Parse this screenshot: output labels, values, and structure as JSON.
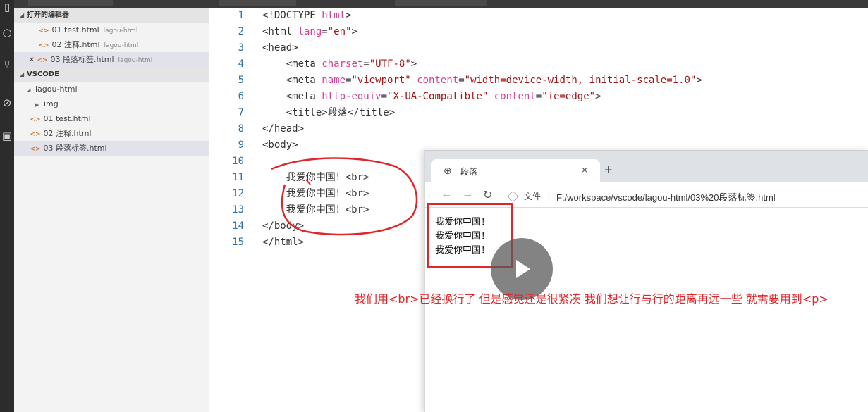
{
  "activity_icons": [
    "files-icon",
    "search-icon",
    "source-control-icon",
    "debug-icon",
    "extensions-icon"
  ],
  "sidebar": {
    "open_editors": {
      "label": "打开的编辑器",
      "items": [
        {
          "name": "01 test.html",
          "project": "lagou-html",
          "active": false
        },
        {
          "name": "02 注释.html",
          "project": "lagou-html",
          "active": false
        },
        {
          "name": "03 段落标签.html",
          "project": "lagou-html",
          "active": true
        }
      ]
    },
    "workspace": {
      "label": "VSCODE",
      "folder": "lagou-html",
      "subfolder": "img",
      "files": [
        "01 test.html",
        "02 注释.html",
        "03 段落标签.html"
      ]
    }
  },
  "editor": {
    "lines": [
      {
        "n": "1",
        "t": [
          [
            "tag",
            "<!DOCTYPE "
          ],
          [
            "doc",
            "html"
          ],
          [
            "tag",
            ">"
          ]
        ]
      },
      {
        "n": "2",
        "t": [
          [
            "tag",
            "<html "
          ],
          [
            "attr",
            "lang"
          ],
          [
            "tag",
            "="
          ],
          [
            "str",
            "\"en\""
          ],
          [
            "tag",
            ">"
          ]
        ]
      },
      {
        "n": "3",
        "t": [
          [
            "tag",
            "<head>"
          ]
        ]
      },
      {
        "n": "4",
        "t": [
          [
            "tag",
            "    <meta "
          ],
          [
            "attr",
            "charset"
          ],
          [
            "tag",
            "="
          ],
          [
            "str",
            "\"UTF-8\""
          ],
          [
            "tag",
            ">"
          ]
        ]
      },
      {
        "n": "5",
        "t": [
          [
            "tag",
            "    <meta "
          ],
          [
            "attr",
            "name"
          ],
          [
            "tag",
            "="
          ],
          [
            "str",
            "\"viewport\""
          ],
          [
            "tag",
            " "
          ],
          [
            "attr",
            "content"
          ],
          [
            "tag",
            "="
          ],
          [
            "str",
            "\"width=device-width, initial-scale=1.0\""
          ],
          [
            "tag",
            ">"
          ]
        ]
      },
      {
        "n": "6",
        "t": [
          [
            "tag",
            "    <meta "
          ],
          [
            "attr",
            "http-equiv"
          ],
          [
            "tag",
            "="
          ],
          [
            "str",
            "\"X-UA-Compatible\""
          ],
          [
            "tag",
            " "
          ],
          [
            "attr",
            "content"
          ],
          [
            "tag",
            "="
          ],
          [
            "str",
            "\"ie=edge\""
          ],
          [
            "tag",
            ">"
          ]
        ]
      },
      {
        "n": "7",
        "t": [
          [
            "tag",
            "    <title>段落</title>"
          ]
        ]
      },
      {
        "n": "8",
        "t": [
          [
            "tag",
            "</head>"
          ]
        ]
      },
      {
        "n": "9",
        "t": [
          [
            "tag",
            "<body>"
          ]
        ]
      },
      {
        "n": "10",
        "t": [
          [
            "tag",
            ""
          ]
        ]
      },
      {
        "n": "11",
        "t": [
          [
            "tag",
            "    我爱你中国！<br>"
          ]
        ]
      },
      {
        "n": "12",
        "t": [
          [
            "tag",
            "    我爱你中国！<br>"
          ]
        ]
      },
      {
        "n": "13",
        "t": [
          [
            "tag",
            "    我爱你中国！<br>"
          ]
        ]
      },
      {
        "n": "14",
        "t": [
          [
            "tag",
            "</body>"
          ]
        ]
      },
      {
        "n": "15",
        "t": [
          [
            "tag",
            "</html>"
          ]
        ]
      }
    ]
  },
  "browser": {
    "tab_title": "段落",
    "new_tab": "+",
    "close": "×",
    "info_icon": "ⓘ",
    "file_label": "文件",
    "separator": "|",
    "url": "F:/workspace/vscode/lagou-html/03%20段落标签.html",
    "content_lines": [
      "我爱你中国！",
      "我爱你中国！",
      "我爱你中国！"
    ]
  },
  "caption": "我们用<br>已经换行了 但是感觉还是很紧凑 我们想让行与行的距离再远一些 就需要用到<p>",
  "colors": {
    "annotation_red": "#e0262a",
    "line_number": "#2b72ae",
    "attr": "#d63f92",
    "string": "#a31515"
  }
}
